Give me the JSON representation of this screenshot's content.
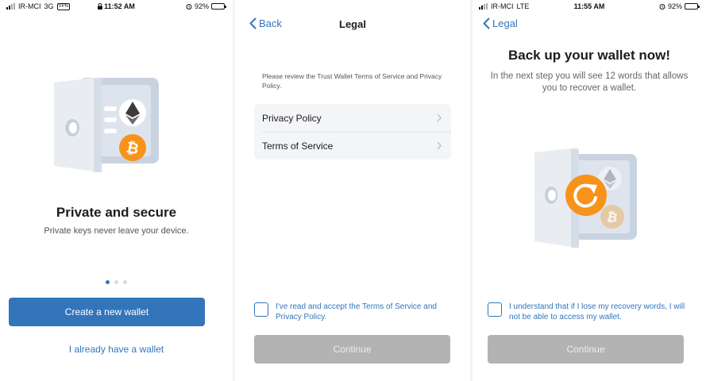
{
  "colors": {
    "accent": "#3375bb",
    "disabled": "#b3b3b3",
    "bitcoin": "#f7931a",
    "ethereum": "#3c3c3d",
    "battery_green": "#34c759"
  },
  "screen1": {
    "status": {
      "carrier": "IR-MCI",
      "network": "3G",
      "vpn": "VPN",
      "time": "11:52 AM",
      "battery": "92%",
      "icons": [
        "signal-bars-icon",
        "lock-icon",
        "alarm-icon",
        "battery-charging-icon"
      ]
    },
    "title": "Private and secure",
    "subtitle": "Private keys never leave your device.",
    "pagination": {
      "pages": 3,
      "active": 0
    },
    "create_button": "Create a new wallet",
    "existing_link": "I already have a wallet"
  },
  "screen2": {
    "status": {
      "battery_level": 0.92
    },
    "nav": {
      "back": "Back",
      "title": "Legal"
    },
    "intro": "Please review the Trust Wallet Terms of Service and Privacy Policy.",
    "items": [
      {
        "label": "Privacy Policy"
      },
      {
        "label": "Terms of Service"
      }
    ],
    "consent": "I've read and accept the Terms of Service and Privacy Policy.",
    "continue": "Continue"
  },
  "screen3": {
    "status": {
      "carrier": "IR-MCI",
      "network": "LTE",
      "time": "11:55 AM",
      "battery": "92%"
    },
    "nav": {
      "back": "Legal"
    },
    "title": "Back up your wallet now!",
    "subtitle": "In the next step you will see 12 words that allows you to recover a wallet.",
    "consent": "I understand that if I lose my recovery words, I will not be able to access my wallet.",
    "continue": "Continue"
  }
}
